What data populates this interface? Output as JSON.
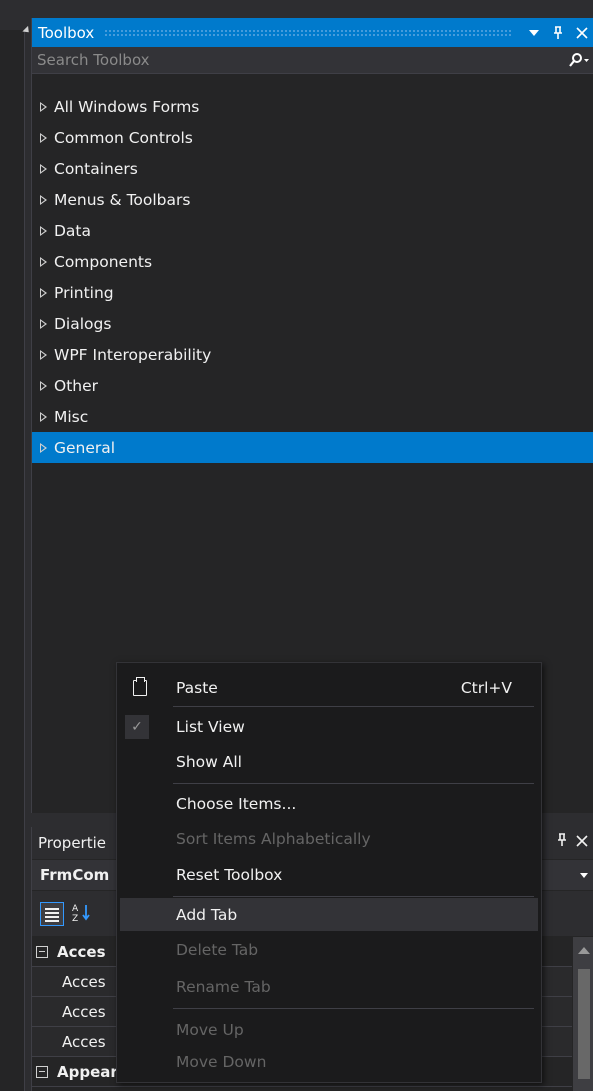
{
  "toolbox": {
    "title": "Toolbox",
    "search_placeholder": "Search Toolbox",
    "pin_glyph": "q",
    "close_glyph": "✕",
    "search_glyph": "⌕",
    "items": [
      {
        "label": "All Windows Forms"
      },
      {
        "label": "Common Controls"
      },
      {
        "label": "Containers"
      },
      {
        "label": "Menus & Toolbars"
      },
      {
        "label": "Data"
      },
      {
        "label": "Components"
      },
      {
        "label": "Printing"
      },
      {
        "label": "Dialogs"
      },
      {
        "label": "WPF Interoperability"
      },
      {
        "label": "Other"
      },
      {
        "label": "Misc"
      },
      {
        "label": "General",
        "selected": true
      }
    ]
  },
  "properties": {
    "title": "Propertie",
    "object": "FrmCom",
    "rows": [
      {
        "label": "Acces",
        "kind": "category"
      },
      {
        "label": "Acces",
        "kind": "sub"
      },
      {
        "label": "Acces",
        "kind": "sub"
      },
      {
        "label": "Acces",
        "kind": "sub"
      },
      {
        "label": "Appearance",
        "kind": "category"
      }
    ]
  },
  "context_menu": {
    "paste_label": "Paste",
    "paste_shortcut": "Ctrl+V",
    "list_view_label": "List View",
    "show_all_label": "Show All",
    "choose_items_label": "Choose Items...",
    "sort_label": "Sort Items Alphabetically",
    "reset_label": "Reset Toolbox",
    "add_tab_label": "Add Tab",
    "delete_tab_label": "Delete Tab",
    "rename_tab_label": "Rename Tab",
    "move_up_label": "Move Up",
    "move_down_label": "Move Down",
    "check_glyph": "✓"
  },
  "colors": {
    "accent": "#007acc",
    "panel_bg": "#252526",
    "menu_bg": "#1b1b1c",
    "disabled_text": "#656565"
  }
}
